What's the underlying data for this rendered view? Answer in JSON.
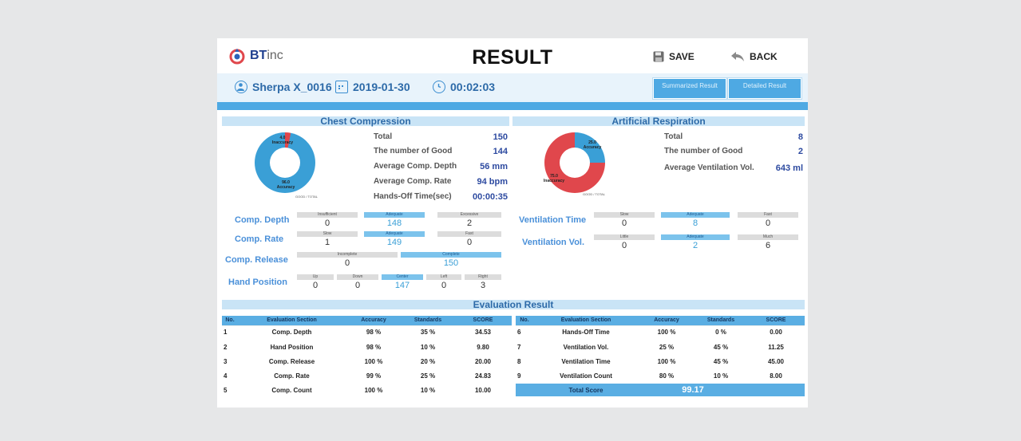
{
  "header": {
    "logo_text": "BT",
    "logo_inc": "inc",
    "title": "RESULT",
    "save_label": "SAVE",
    "back_label": "BACK"
  },
  "session": {
    "user": "Sherpa X_0016",
    "date": "2019-01-30",
    "time": "00:02:03"
  },
  "tabs": [
    {
      "label": "Summarized Result",
      "active": true
    },
    {
      "label": "Detailed Result",
      "active": false
    }
  ],
  "chest_compression": {
    "title": "Chest Compression",
    "donut": {
      "inaccuracy_label": "4.0\nInaccuracy",
      "accuracy_label": "96.0\nAccuracy",
      "legend": "GOOD / TOTAL",
      "accuracy_pct": 96
    },
    "stats": [
      {
        "label": "Total",
        "value": "150"
      },
      {
        "label": "The number of Good",
        "value": "144"
      },
      {
        "label": "Average Comp. Depth",
        "value": "56 mm"
      },
      {
        "label": "Average Comp. Rate",
        "value": "94 bpm"
      },
      {
        "label": "Hands-Off Time(sec)",
        "value": "00:00:35"
      }
    ],
    "metrics": {
      "depth": {
        "label": "Comp. Depth",
        "cells": [
          {
            "h": "Insufficient",
            "v": "0"
          },
          {
            "h": "Adequate",
            "v": "148"
          },
          {
            "h": "Excessive",
            "v": "2"
          }
        ]
      },
      "rate": {
        "label": "Comp. Rate",
        "cells": [
          {
            "h": "Slow",
            "v": "1"
          },
          {
            "h": "Adequate",
            "v": "149"
          },
          {
            "h": "Fast",
            "v": "0"
          }
        ]
      },
      "release": {
        "label": "Comp. Release",
        "cells": [
          {
            "h": "Incomplete",
            "v": "0"
          },
          {
            "h": "Complete",
            "v": "150"
          }
        ]
      },
      "position": {
        "label": "Hand Position",
        "cells": [
          {
            "h": "Up",
            "v": "0"
          },
          {
            "h": "Down",
            "v": "0"
          },
          {
            "h": "Center",
            "v": "147"
          },
          {
            "h": "Left",
            "v": "0"
          },
          {
            "h": "Right",
            "v": "3"
          }
        ]
      }
    }
  },
  "artificial_respiration": {
    "title": "Artificial Respiration",
    "donut": {
      "accuracy_label": "25.0\nAccuracy",
      "inaccuracy_label": "75.0\nInaccuracy",
      "legend": "GOOD / TOTAL",
      "accuracy_pct": 25
    },
    "stats": [
      {
        "label": "Total",
        "value": "8"
      },
      {
        "label": "The number of Good",
        "value": "2"
      },
      {
        "label": "Average Ventilation Vol.",
        "value": "643 ml"
      }
    ],
    "metrics": {
      "time": {
        "label": "Ventilation Time",
        "cells": [
          {
            "h": "Slow",
            "v": "0"
          },
          {
            "h": "Adequate",
            "v": "8"
          },
          {
            "h": "Fast",
            "v": "0"
          }
        ]
      },
      "vol": {
        "label": "Ventilation Vol.",
        "cells": [
          {
            "h": "Little",
            "v": "0"
          },
          {
            "h": "Adequate",
            "v": "2"
          },
          {
            "h": "Much",
            "v": "6"
          }
        ]
      }
    }
  },
  "evaluation": {
    "title": "Evaluation Result",
    "headers": [
      "No.",
      "Evaluation Section",
      "Accuracy",
      "Standards",
      "SCORE"
    ],
    "left_rows": [
      [
        "1",
        "Comp. Depth",
        "98 %",
        "35 %",
        "34.53"
      ],
      [
        "2",
        "Hand Position",
        "98 %",
        "10 %",
        "9.80"
      ],
      [
        "3",
        "Comp. Release",
        "100 %",
        "20 %",
        "20.00"
      ],
      [
        "4",
        "Comp. Rate",
        "99 %",
        "25 %",
        "24.83"
      ],
      [
        "5",
        "Comp. Count",
        "100 %",
        "10 %",
        "10.00"
      ]
    ],
    "right_rows": [
      [
        "6",
        "Hands-Off Time",
        "100 %",
        "0 %",
        "0.00"
      ],
      [
        "7",
        "Ventilation Vol.",
        "25 %",
        "45 %",
        "11.25"
      ],
      [
        "8",
        "Ventilation Time",
        "100 %",
        "45 %",
        "45.00"
      ],
      [
        "9",
        "Ventilation Count",
        "80 %",
        "10 %",
        "8.00"
      ]
    ],
    "total_label": "Total Score",
    "total_value": "99.17"
  }
}
